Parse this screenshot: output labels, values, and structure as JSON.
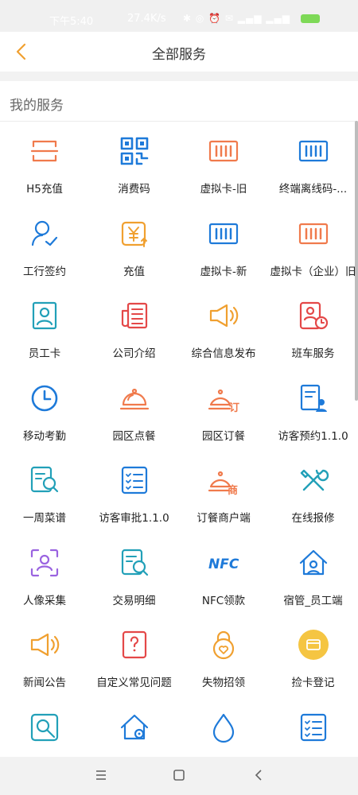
{
  "status_bar": {
    "time": "下午5:40",
    "speed": "27.4K/s"
  },
  "header": {
    "title": "全部服务"
  },
  "section": {
    "title": "我的服务"
  },
  "services": [
    {
      "label": "H5充值",
      "icon": "scan-icon"
    },
    {
      "label": "消费码",
      "icon": "qr-code-icon"
    },
    {
      "label": "虚拟卡-旧",
      "icon": "barcode-card-icon"
    },
    {
      "label": "终端离线码-...",
      "icon": "barcode-card-icon"
    },
    {
      "label": "工行签约",
      "icon": "user-check-icon"
    },
    {
      "label": "充值",
      "icon": "yuan-recharge-icon"
    },
    {
      "label": "虚拟卡-新",
      "icon": "barcode-card-icon"
    },
    {
      "label": "虚拟卡（企业）旧",
      "icon": "barcode-card-icon"
    },
    {
      "label": "员工卡",
      "icon": "employee-card-icon"
    },
    {
      "label": "公司介绍",
      "icon": "newspaper-icon"
    },
    {
      "label": "综合信息发布",
      "icon": "megaphone-icon"
    },
    {
      "label": "班车服务",
      "icon": "bus-schedule-icon"
    },
    {
      "label": "移动考勤",
      "icon": "clock-icon"
    },
    {
      "label": "园区点餐",
      "icon": "food-cloche-icon"
    },
    {
      "label": "园区订餐",
      "icon": "food-cloche-order-icon"
    },
    {
      "label": "访客预约1.1.0",
      "icon": "visitor-reservation-icon"
    },
    {
      "label": "一周菜谱",
      "icon": "menu-search-icon"
    },
    {
      "label": "访客审批1.1.0",
      "icon": "checklist-icon"
    },
    {
      "label": "订餐商户端",
      "icon": "food-cloche-merchant-icon"
    },
    {
      "label": "在线报修",
      "icon": "repair-tools-icon"
    },
    {
      "label": "人像采集",
      "icon": "face-capture-icon"
    },
    {
      "label": "交易明细",
      "icon": "document-search-icon"
    },
    {
      "label": "NFC领款",
      "icon": "nfc-icon"
    },
    {
      "label": "宿管_员工端",
      "icon": "house-user-icon"
    },
    {
      "label": "新闻公告",
      "icon": "megaphone-icon"
    },
    {
      "label": "自定义常见问题",
      "icon": "question-icon"
    },
    {
      "label": "失物招领",
      "icon": "lock-heart-icon"
    },
    {
      "label": "捡卡登记",
      "icon": "card-coin-icon"
    },
    {
      "label": "",
      "icon": "magnifier-icon"
    },
    {
      "label": "",
      "icon": "house-settings-icon"
    },
    {
      "label": "",
      "icon": "water-drop-icon"
    },
    {
      "label": "",
      "icon": "checklist-icon"
    }
  ],
  "colors": {
    "accent_orange": "#f0a030",
    "icon_orange": "#f07a4c",
    "icon_blue": "#1e7ad9",
    "icon_cyan": "#22a0b8",
    "icon_purple": "#9a63e0",
    "icon_red": "#e44848",
    "yellow": "#f5c542"
  }
}
